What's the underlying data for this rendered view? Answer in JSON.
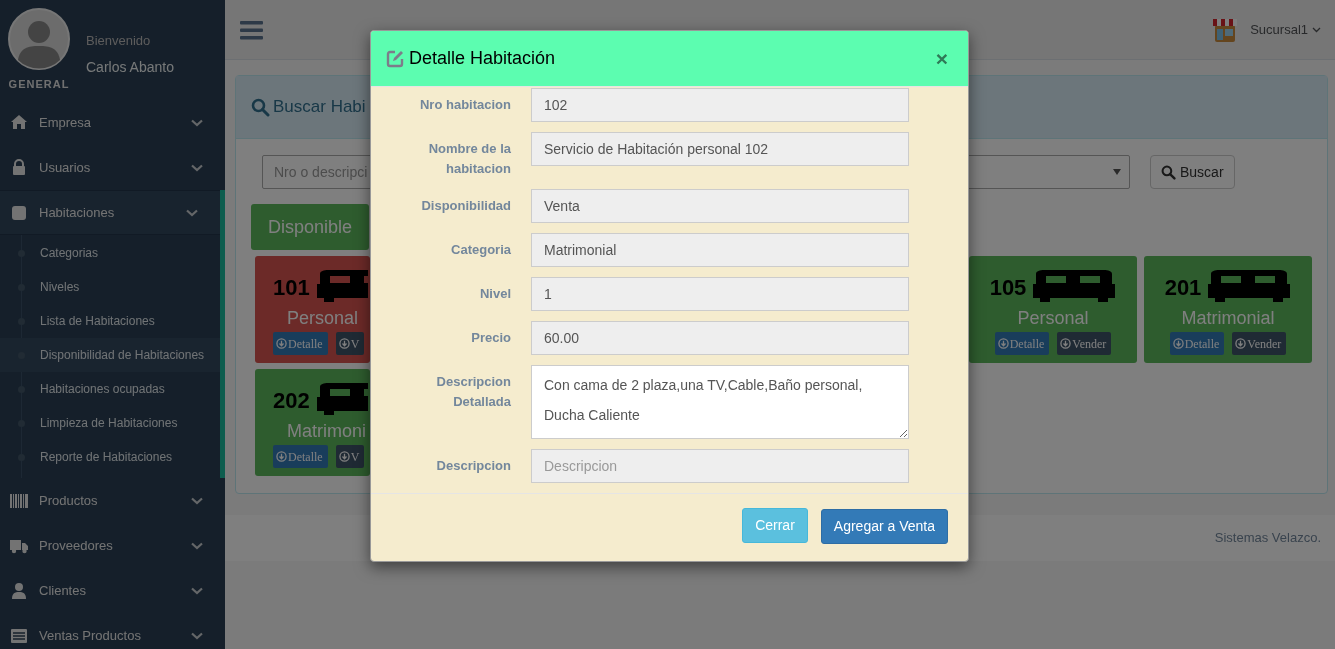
{
  "sidebar": {
    "greeting": "Bienvenido",
    "user": "Carlos Abanto",
    "role": "GENERAL",
    "menu": [
      {
        "label": "Empresa",
        "expanded": false
      },
      {
        "label": "Usuarios",
        "expanded": false
      },
      {
        "label": "Habitaciones",
        "expanded": true,
        "children": [
          {
            "label": "Categorias",
            "selected": false
          },
          {
            "label": "Niveles",
            "selected": false
          },
          {
            "label": "Lista de Habitaciones",
            "selected": false
          },
          {
            "label": "Disponibilidad de Habitaciones",
            "selected": true
          },
          {
            "label": "Habitaciones ocupadas",
            "selected": false
          },
          {
            "label": "Limpieza de Habitaciones",
            "selected": false
          },
          {
            "label": "Reporte de Habitaciones",
            "selected": false
          }
        ]
      },
      {
        "label": "Productos",
        "expanded": false
      },
      {
        "label": "Proveedores",
        "expanded": false
      },
      {
        "label": "Clientes",
        "expanded": false
      },
      {
        "label": "Ventas Productos",
        "expanded": false
      }
    ]
  },
  "topbar": {
    "branch": "Sucursal1"
  },
  "panel": {
    "title": "Buscar Habi",
    "search": {
      "placeholder": "Nro o descripci"
    },
    "search_button": "Buscar",
    "filter_tab": "Disponible",
    "room_rows": [
      [
        {
          "number": "101",
          "category": "Personal",
          "color": "#6c2a28",
          "buttons": [
            "Detalle",
            "V"
          ]
        },
        {
          "number": "105",
          "category": "Personal",
          "color": "#2e5c2e",
          "buttons": [
            "Detalle",
            "Vender"
          ]
        },
        {
          "number": "201",
          "category": "Matrimonial",
          "color": "#2e5c2e",
          "buttons": [
            "Detalle",
            "Vender"
          ]
        }
      ],
      [
        {
          "number": "202",
          "category": "Matrimoni",
          "color": "#2e5c2e",
          "buttons": [
            "Detalle",
            "V"
          ]
        }
      ]
    ]
  },
  "footer": "Sistemas Velazco.",
  "modal": {
    "title": "Detalle Habitación",
    "close": "×",
    "fields": [
      {
        "label": "Nro habitacion",
        "value": "102",
        "kind": "input"
      },
      {
        "label": "Nombre de la habitacion",
        "value": "Servicio de Habitación personal 102",
        "kind": "input"
      },
      {
        "label": "Disponibilidad",
        "value": "Venta",
        "kind": "input"
      },
      {
        "label": "Categoria",
        "value": "Matrimonial",
        "kind": "input"
      },
      {
        "label": "Nivel",
        "value": "1",
        "kind": "input"
      },
      {
        "label": "Precio",
        "value": "60.00",
        "kind": "input"
      },
      {
        "label": "Descripcion Detallada",
        "value": "Con cama de 2 plaza,una TV,Cable,Baño personal, Ducha Caliente",
        "kind": "textarea"
      },
      {
        "label": "Descripcion",
        "placeholder": "Descripcion",
        "kind": "input"
      }
    ],
    "buttons": [
      {
        "label": "Cerrar",
        "kind": "info"
      },
      {
        "label": "Agregar a Venta",
        "kind": "primary"
      }
    ]
  }
}
